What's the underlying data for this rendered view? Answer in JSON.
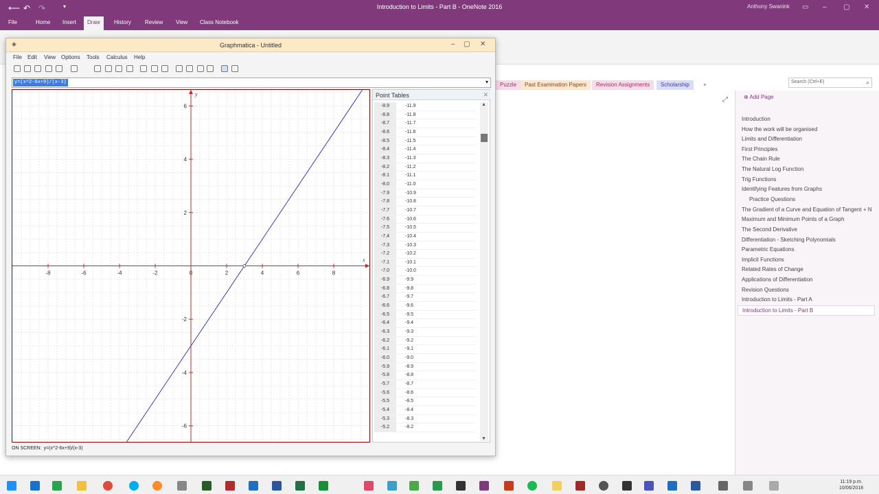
{
  "onenote": {
    "title": "Introduction to Limits - Part B - OneNote 2016",
    "user": "Anthony Swanink",
    "tabs": [
      "File",
      "Home",
      "Insert",
      "Draw",
      "History",
      "Review",
      "View",
      "Class Notebook"
    ],
    "active_tab": "Draw",
    "section_tabs": [
      "Puzzle",
      "Past Examination Papers",
      "Revision Assignments",
      "Scholarship"
    ],
    "add_section_tab": "+",
    "search_placeholder": "Search (Ctrl+E)",
    "add_page": "Add Page",
    "pages": [
      "Introduction",
      "How the work will be organised",
      "Limits and Differentiation",
      "First Principles",
      "The Chain Rule",
      "The Natural Log Function",
      "Trig Functions",
      "Identifying Features from Graphs",
      "Practice Questions",
      "The Gradient of a Curve and Equation of Tangent + N",
      "Maximum and Minimum Points of a Graph",
      "The Second Derivative",
      "Differentiation - Sketching Polynomials",
      "Parametric Equations",
      "Implicit Functions",
      "Related Rates of Change",
      "Applications of Differentiation",
      "Revision Questions",
      "Introduction to Limits - Part A",
      "Introduction to Limits - Part B"
    ],
    "selected_page": "Introduction to Limits - Part B",
    "subpage": "Practice Questions"
  },
  "graphmatica": {
    "title": "Graphmatica - Untitled",
    "menu": [
      "File",
      "Edit",
      "View",
      "Options",
      "Tools",
      "Calculus",
      "Help"
    ],
    "equation": "y=(x^2-6x+9)/(x-3)",
    "status_label": "ON SCREEN:",
    "status_eq": "y=(x^2-6x+9)/(x-3)",
    "point_tables_title": "Point Tables",
    "points": [
      [
        "-8.9",
        "-11.9"
      ],
      [
        "-8.8",
        "-11.8"
      ],
      [
        "-8.7",
        "-11.7"
      ],
      [
        "-8.6",
        "-11.6"
      ],
      [
        "-8.5",
        "-11.5"
      ],
      [
        "-8.4",
        "-11.4"
      ],
      [
        "-8.3",
        "-11.3"
      ],
      [
        "-8.2",
        "-11.2"
      ],
      [
        "-8.1",
        "-11.1"
      ],
      [
        "-8.0",
        "-11.0"
      ],
      [
        "-7.9",
        "-10.9"
      ],
      [
        "-7.8",
        "-10.8"
      ],
      [
        "-7.7",
        "-10.7"
      ],
      [
        "-7.6",
        "-10.6"
      ],
      [
        "-7.5",
        "-10.5"
      ],
      [
        "-7.4",
        "-10.4"
      ],
      [
        "-7.3",
        "-10.3"
      ],
      [
        "-7.2",
        "-10.2"
      ],
      [
        "-7.1",
        "-10.1"
      ],
      [
        "-7.0",
        "-10.0"
      ],
      [
        "-6.9",
        "-9.9"
      ],
      [
        "-6.8",
        "-9.8"
      ],
      [
        "-6.7",
        "-9.7"
      ],
      [
        "-6.6",
        "-9.6"
      ],
      [
        "-6.5",
        "-9.5"
      ],
      [
        "-6.4",
        "-9.4"
      ],
      [
        "-6.3",
        "-9.3"
      ],
      [
        "-6.2",
        "-9.2"
      ],
      [
        "-6.1",
        "-9.1"
      ],
      [
        "-6.0",
        "-9.0"
      ],
      [
        "-5.9",
        "-8.9"
      ],
      [
        "-5.8",
        "-8.8"
      ],
      [
        "-5.7",
        "-8.7"
      ],
      [
        "-5.6",
        "-8.6"
      ],
      [
        "-5.5",
        "-8.5"
      ],
      [
        "-5.4",
        "-8.4"
      ],
      [
        "-5.3",
        "-8.3"
      ],
      [
        "-5.2",
        "-8.2"
      ]
    ]
  },
  "chart_data": {
    "type": "line",
    "xlim": [
      -10,
      10
    ],
    "ylim": [
      -6.6,
      6.6
    ],
    "x_ticks": [
      "-8",
      "-6",
      "-4",
      "-2",
      "0",
      "2",
      "4",
      "6",
      "8"
    ],
    "y_ticks": [
      "6",
      "4",
      "2",
      "0",
      "-2",
      "-4",
      "-6"
    ],
    "xlabel": "x",
    "ylabel": "y",
    "grid": true,
    "series": [
      {
        "x": [
          -3.6,
          9.9
        ],
        "y": [
          -6.6,
          6.9
        ]
      }
    ],
    "colors": {
      "line": "#3b3bb5",
      "axis": "#d42020",
      "grid": "#d8d8d8"
    }
  },
  "taskbar": {
    "time": "11:19 p.m.",
    "date": "10/06/2018"
  }
}
